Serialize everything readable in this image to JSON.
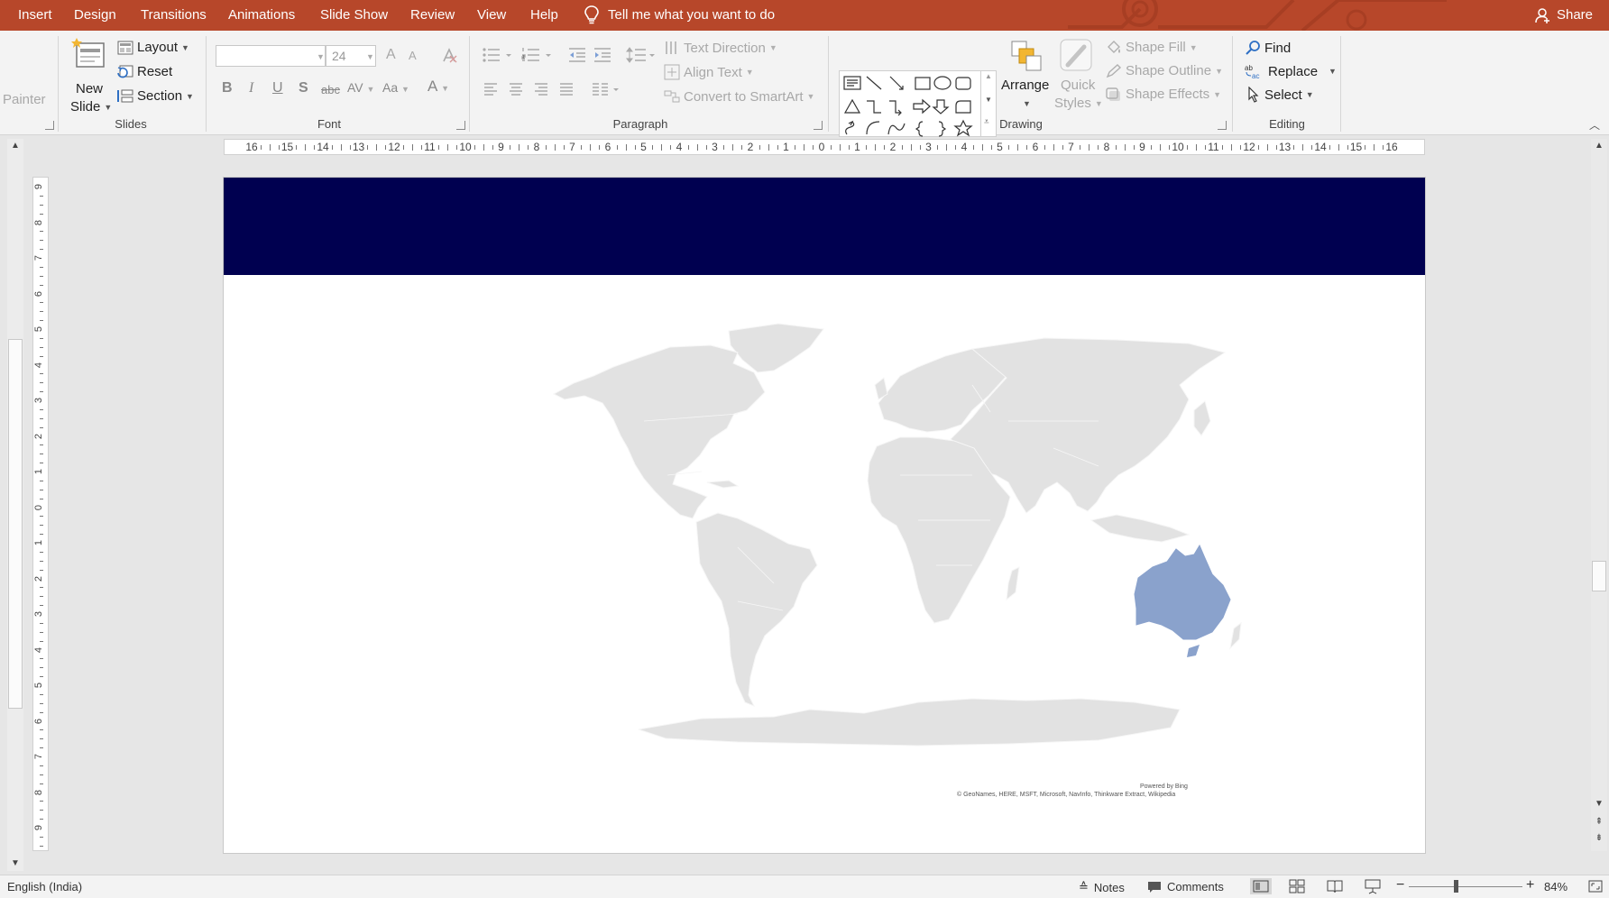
{
  "tabs": [
    "Insert",
    "Design",
    "Transitions",
    "Animations",
    "Slide Show",
    "Review",
    "View",
    "Help"
  ],
  "tell_me": "Tell me what you want to do",
  "share": "Share",
  "ribbon": {
    "clipboard": {
      "painter": "Painter"
    },
    "slides": {
      "group_label": "Slides",
      "new_slide_line1": "New",
      "new_slide_line2": "Slide",
      "layout": "Layout",
      "reset": "Reset",
      "section": "Section"
    },
    "font": {
      "group_label": "Font",
      "font_name": "",
      "font_size": "24",
      "bold": "B",
      "italic": "I",
      "underline": "U",
      "shadow": "S",
      "strike": "abc",
      "spacing": "AV",
      "case": "Aa",
      "color": "A",
      "grow": "A",
      "shrink": "A"
    },
    "paragraph": {
      "group_label": "Paragraph",
      "text_direction": "Text Direction",
      "align_text": "Align Text",
      "smartart": "Convert to SmartArt"
    },
    "drawing": {
      "group_label": "Drawing",
      "arrange": "Arrange",
      "quick_styles_line1": "Quick",
      "quick_styles_line2": "Styles",
      "shape_fill": "Shape Fill",
      "shape_outline": "Shape Outline",
      "shape_effects": "Shape Effects"
    },
    "editing": {
      "group_label": "Editing",
      "find": "Find",
      "replace": "Replace",
      "select": "Select"
    }
  },
  "ruler": {
    "h_labels": [
      "16",
      "15",
      "14",
      "13",
      "12",
      "11",
      "10",
      "9",
      "8",
      "7",
      "6",
      "5",
      "4",
      "3",
      "2",
      "1",
      "0",
      "1",
      "2",
      "3",
      "4",
      "5",
      "6",
      "7",
      "8",
      "9",
      "10",
      "11",
      "12",
      "13",
      "14",
      "15",
      "16"
    ],
    "v_labels": [
      "9",
      "8",
      "7",
      "6",
      "5",
      "4",
      "3",
      "2",
      "1",
      "0",
      "1",
      "2",
      "3",
      "4",
      "5",
      "6",
      "7",
      "8",
      "9"
    ]
  },
  "slide": {
    "banner_color": "#000050",
    "map": {
      "land_color": "#e2e2e2",
      "highlight_color": "#8aa2cc",
      "highlighted_region": "Australia",
      "attribution_line1": "Powered by Bing",
      "attribution_line2": "© GeoNames, HERE, MSFT, Microsoft, NavInfo, Thinkware Extract, Wikipedia"
    }
  },
  "status": {
    "language": "English (India)",
    "notes": "Notes",
    "comments": "Comments",
    "zoom": "84%"
  },
  "colors": {
    "accent": "#b7472a",
    "ribbon_bg": "#f3f3f3",
    "workspace_bg": "#e6e6e6"
  }
}
